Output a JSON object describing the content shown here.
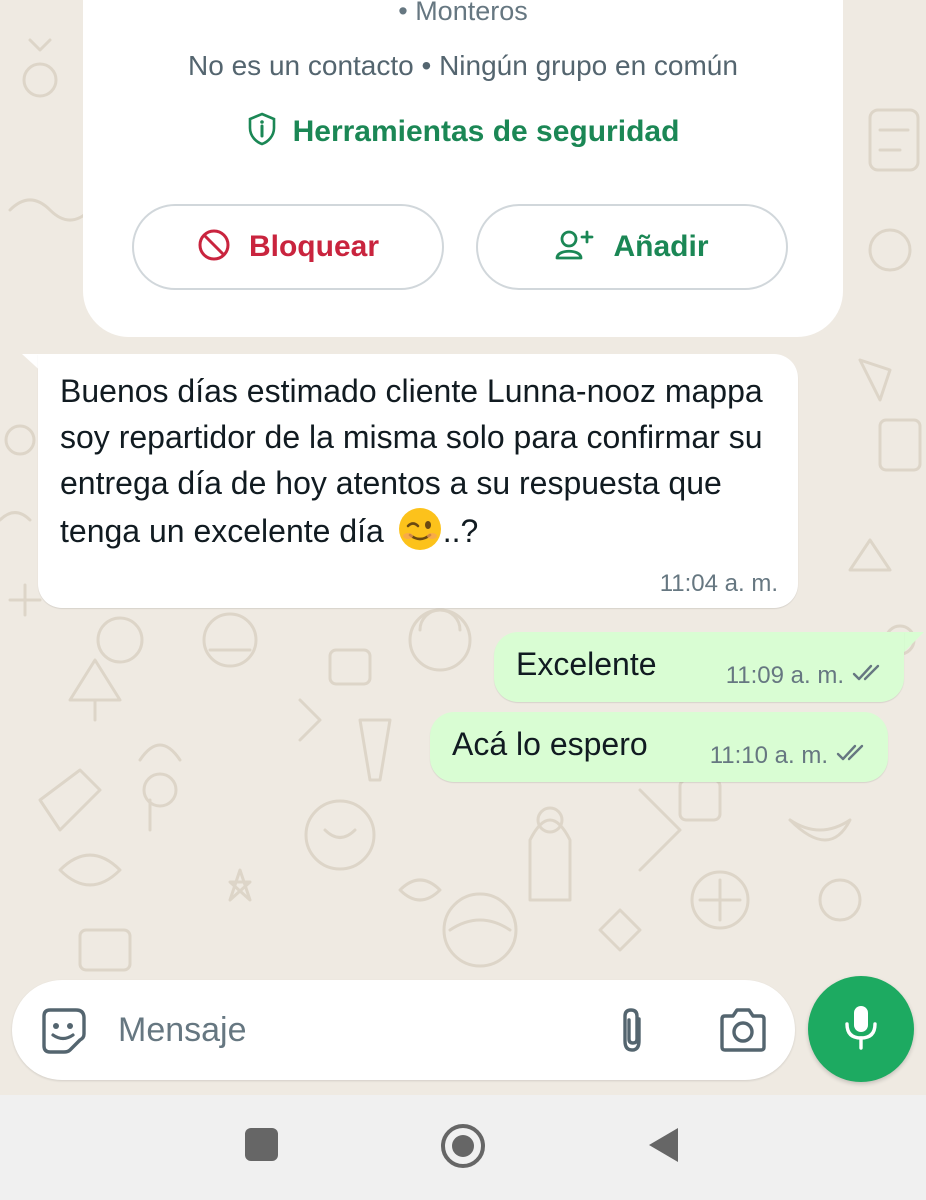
{
  "contact_card": {
    "partial_top_text": "• Monteros",
    "status_line": "No es un contacto • Ningún grupo en común",
    "safety_tools_label": "Herramientas de seguridad",
    "safety_icon": "shield-info-icon",
    "block_label": "Bloquear",
    "block_icon": "block-icon",
    "add_label": "Añadir",
    "add_icon": "add-person-icon"
  },
  "messages": [
    {
      "direction": "incoming",
      "text": "Buenos días estimado cliente Lunna-nooz mappa soy repartidor de la misma solo para confirmar su entrega día de hoy atentos a su respuesta que tenga un excelente día",
      "emoji": "winking-face",
      "suffix": "..?",
      "time": "11:04 a. m."
    },
    {
      "direction": "outgoing",
      "text": "Excelente",
      "time": "11:09 a. m.",
      "status": "read"
    },
    {
      "direction": "outgoing",
      "text": "Acá lo espero",
      "time": "11:10 a. m.",
      "status": "read"
    }
  ],
  "composer": {
    "placeholder": "Mensaje",
    "sticker_icon": "sticker-icon",
    "attach_icon": "paperclip-icon",
    "camera_icon": "camera-icon",
    "mic_icon": "microphone-icon"
  },
  "nav_bar": {
    "icons": [
      "recents-icon",
      "home-icon",
      "back-icon"
    ]
  },
  "colors": {
    "chat_background": "#efeae2",
    "outgoing_bubble": "#d9fdd3",
    "accent_green": "#1b8755",
    "mic_green": "#1daa61",
    "block_red": "#c9243e"
  }
}
